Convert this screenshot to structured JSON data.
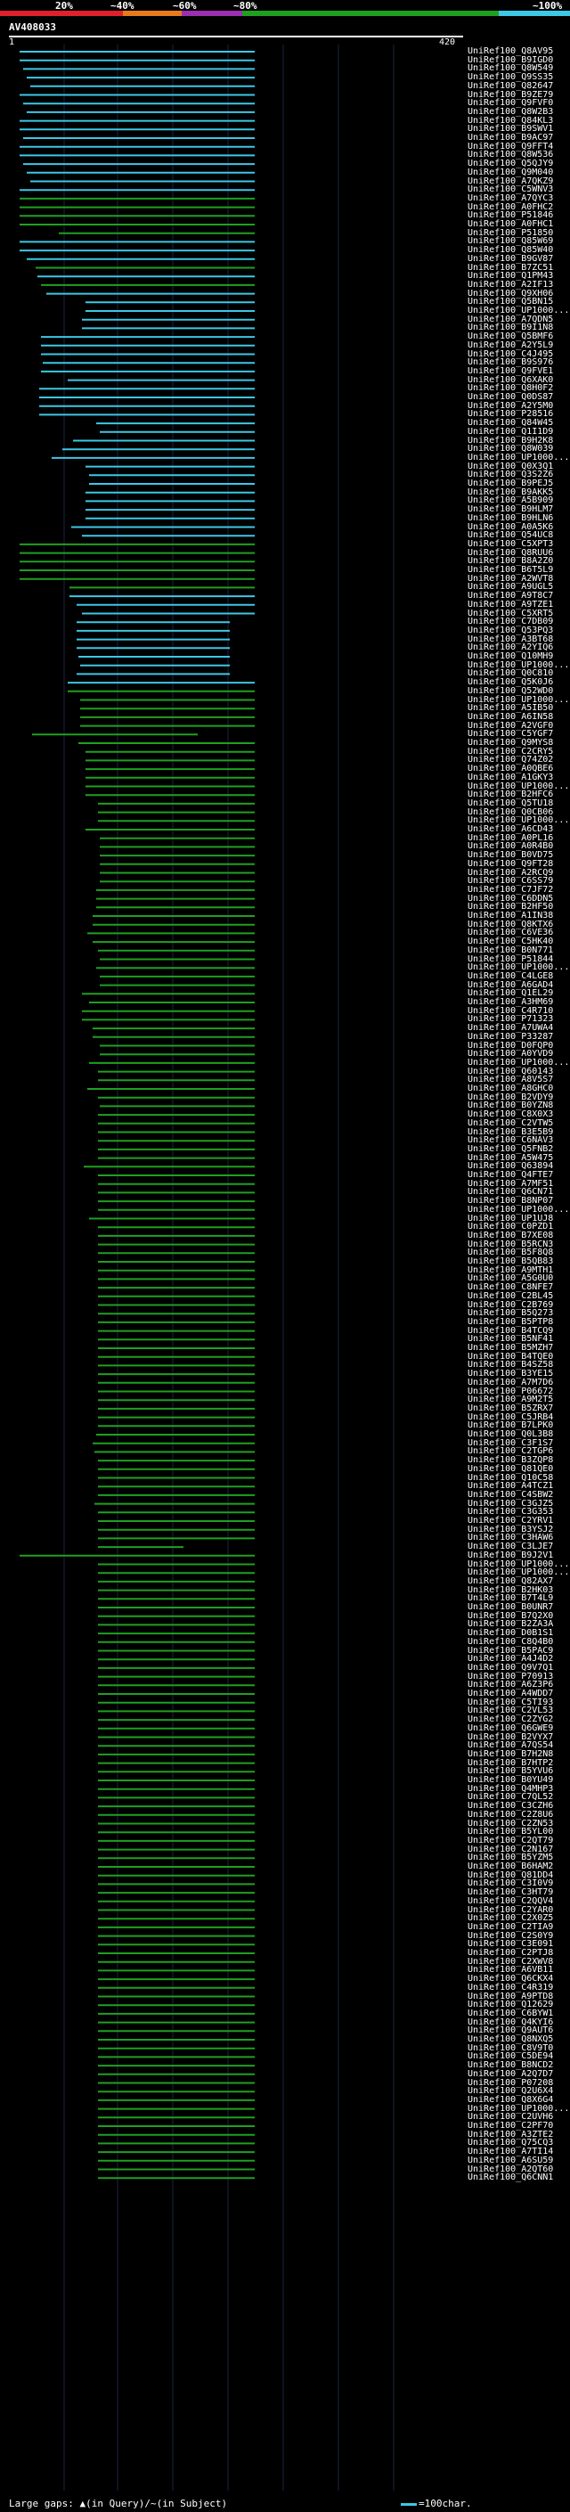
{
  "legend": {
    "labels": [
      "20%",
      "~40%",
      "~60%",
      "~80%",
      "~100%"
    ],
    "colors": [
      "#e0202a",
      "#e87a1c",
      "#9b2fb0",
      "#1fa01f",
      "#3cc8e6"
    ]
  },
  "query_id": "AV408033",
  "scale": {
    "start": "1",
    "end": "420"
  },
  "accessions": [
    "UniRef100_Q8AV95",
    "UniRef100_B9IGD0",
    "UniRef100_Q8W549",
    "UniRef100_Q9SS35",
    "UniRef100_Q82647",
    "UniRef100_B9ZE79",
    "UniRef100_Q9FVF0",
    "UniRef100_Q8W2B3",
    "UniRef100_Q84KL3",
    "UniRef100_B9SWV1",
    "UniRef100_B9AC97",
    "UniRef100_Q9FFT4",
    "UniRef100_Q8W536",
    "UniRef100_Q5QJY9",
    "UniRef100_Q9M040",
    "UniRef100_A7QKZ9",
    "UniRef100_C5WNV3",
    "UniRef100_A7QYC3",
    "UniRef100_A0FHC2",
    "UniRef100_P51846",
    "UniRef100_A0FHC1",
    "UniRef100_P51850",
    "UniRef100_Q85W69",
    "UniRef100_Q85W40",
    "UniRef100_B9GV87",
    "UniRef100_B7ZC51",
    "UniRef100_Q1PM43",
    "UniRef100_A2IF13",
    "UniRef100_Q9XH06",
    "UniRef100_Q5BN15",
    "UniRef100_UP1000...",
    "UniRef100_A7QDN5",
    "UniRef100_B9I1N8",
    "UniRef100_Q5BMF6",
    "UniRef100_A2Y5L9",
    "UniRef100_C4J495",
    "UniRef100_B9S976",
    "UniRef100_Q9FVE1",
    "UniRef100_Q6XAK0",
    "UniRef100_Q8H0F2",
    "UniRef100_Q0DS87",
    "UniRef100_A2Y5M0",
    "UniRef100_P28516",
    "UniRef100_Q84W45",
    "UniRef100_Q1I1D9",
    "UniRef100_B9H2K8",
    "UniRef100_Q8W039",
    "UniRef100_UP1000...",
    "UniRef100_Q0X3Q1",
    "UniRef100_Q3S2Z6",
    "UniRef100_B9PEJ5",
    "UniRef100_B9AKK5",
    "UniRef100_A5B909",
    "UniRef100_B9HLM7",
    "UniRef100_B9HLN6",
    "UniRef100_A0A5K6",
    "UniRef100_Q54UC8",
    "UniRef100_C5XPT3",
    "UniRef100_Q8RUU6",
    "UniRef100_B8A2Z0",
    "UniRef100_B6T5L9",
    "UniRef100_A2WVT8",
    "UniRef100_A9UGL5",
    "UniRef100_A9T8C7",
    "UniRef100_A9TZE1",
    "UniRef100_C5XRT5",
    "UniRef100_C7DB09",
    "UniRef100_Q53PQ3",
    "UniRef100_A3BT68",
    "UniRef100_A2YIQ6",
    "UniRef100_Q10MH9",
    "UniRef100_UP1000...",
    "UniRef100_Q0C810",
    "UniRef100_Q5K0J6",
    "UniRef100_Q52WD0",
    "UniRef100_UP1000...",
    "UniRef100_A5IB50",
    "UniRef100_A6IN58",
    "UniRef100_A2VGF0",
    "UniRef100_C5YGF7",
    "UniRef100_Q9MYS8",
    "UniRef100_C2CRY5",
    "UniRef100_Q74Z02",
    "UniRef100_A0QBE6",
    "UniRef100_A1GKY3",
    "UniRef100_UP1000...",
    "UniRef100_B2HFC6",
    "UniRef100_Q5TU18",
    "UniRef100_Q0CB06",
    "UniRef100_UP1000...",
    "UniRef100_A6CD43",
    "UniRef100_A0PL16",
    "UniRef100_A0R4B0",
    "UniRef100_B0VD75",
    "UniRef100_Q9FT28",
    "UniRef100_A2RCQ9",
    "UniRef100_C6SS79",
    "UniRef100_C7JF72",
    "UniRef100_C6DDN5",
    "UniRef100_B2HF50",
    "UniRef100_A1IN38",
    "UniRef100_Q8KTX6",
    "UniRef100_C6VE36",
    "UniRef100_C5HK40",
    "UniRef100_B0N771",
    "UniRef100_P51844",
    "UniRef100_UP1000...",
    "UniRef100_C4LGE8",
    "UniRef100_A6GAD4",
    "UniRef100_Q1EL29",
    "UniRef100_A3HM69",
    "UniRef100_C4R710",
    "UniRef100_P71323",
    "UniRef100_A7UWA4",
    "UniRef100_P33287",
    "UniRef100_D0FQP0",
    "UniRef100_A0YVD9",
    "UniRef100_UP1000...",
    "UniRef100_Q60143",
    "UniRef100_A8V5S7",
    "UniRef100_A8GHC0",
    "UniRef100_B2VDY9",
    "UniRef100_B0YZN8",
    "UniRef100_C8X0X3",
    "UniRef100_C2VTW5",
    "UniRef100_B3E5B9",
    "UniRef100_C6NAV3",
    "UniRef100_Q5FNB2",
    "UniRef100_A5W475",
    "UniRef100_Q63894",
    "UniRef100_Q4FTE7",
    "UniRef100_A7MF51",
    "UniRef100_Q6CN71",
    "UniRef100_B8NP07",
    "UniRef100_UP1000...",
    "UniRef100_UP1UJ8",
    "UniRef100_C0PZD1",
    "UniRef100_B7XE08",
    "UniRef100_B5RCN3",
    "UniRef100_B5F8Q8",
    "UniRef100_B5QB83",
    "UniRef100_A9MTH1",
    "UniRef100_A5G0U0",
    "UniRef100_C8NFE7",
    "UniRef100_C2BL45",
    "UniRef100_C2B769",
    "UniRef100_B5Q273",
    "UniRef100_B5PTP8",
    "UniRef100_B4TCQ9",
    "UniRef100_B5NF41",
    "UniRef100_B5MZH7",
    "UniRef100_B4TQE0",
    "UniRef100_B4SZ58",
    "UniRef100_B3YE15",
    "UniRef100_A7M7D6",
    "UniRef100_P06672",
    "UniRef100_A9M2T5",
    "UniRef100_B5ZRX7",
    "UniRef100_C5JRB4",
    "UniRef100_B7LPK0",
    "UniRef100_Q0L3B8",
    "UniRef100_C3F1S7",
    "UniRef100_C2TGP6",
    "UniRef100_B3ZQP8",
    "UniRef100_Q81QE0",
    "UniRef100_Q10C58",
    "UniRef100_A4TCZ1",
    "UniRef100_C4SBW2",
    "UniRef100_C3GJZ5",
    "UniRef100_C3G353",
    "UniRef100_C2YRV1",
    "UniRef100_B3YSJ2",
    "UniRef100_C3HAW6",
    "UniRef100_C3LJE7",
    "UniRef100_B9J2V1",
    "UniRef100_UP1000...",
    "UniRef100_UP1000...",
    "UniRef100_Q82AX7",
    "UniRef100_B2HK03",
    "UniRef100_B7T4L9",
    "UniRef100_B0UNR7",
    "UniRef100_B7Q2X0",
    "UniRef100_B2ZA3A",
    "UniRef100_D0B1S1",
    "UniRef100_C8Q4B0",
    "UniRef100_B5PAC9",
    "UniRef100_A4J4D2",
    "UniRef100_Q9V7Q1",
    "UniRef100_P70913",
    "UniRef100_A6Z3P6",
    "UniRef100_A4WDD7",
    "UniRef100_C5TI93",
    "UniRef100_C2VL53",
    "UniRef100_C2ZYG2",
    "UniRef100_Q6GWE9",
    "UniRef100_B2VYX7",
    "UniRef100_A7QS54",
    "UniRef100_B7H2N8",
    "UniRef100_B7HTP2",
    "UniRef100_B5YVU6",
    "UniRef100_B0YU49",
    "UniRef100_Q4MHP3",
    "UniRef100_C7QL52",
    "UniRef100_C3CZH6",
    "UniRef100_C2Z8U6",
    "UniRef100_C2ZN53",
    "UniRef100_B5YL00",
    "UniRef100_C2QT79",
    "UniRef100_C2N167",
    "UniRef100_B5YZM5",
    "UniRef100_B6HAM2",
    "UniRef100_Q81DD4",
    "UniRef100_C3I0V9",
    "UniRef100_C3HT79",
    "UniRef100_C2QQV4",
    "UniRef100_C2YAR0",
    "UniRef100_C2X0Z5",
    "UniRef100_C2TIA9",
    "UniRef100_C2S0Y9",
    "UniRef100_C3E091",
    "UniRef100_C2PTJ8",
    "UniRef100_C2XWV8",
    "UniRef100_A6VB11",
    "UniRef100_Q6CKX4",
    "UniRef100_C4R319",
    "UniRef100_A9PTD8",
    "UniRef100_Q12629",
    "UniRef100_C6BYW1",
    "UniRef100_Q4KYI6",
    "UniRef100_Q9AUT6",
    "UniRef100_Q8NXQ5",
    "UniRef100_C8V9T0",
    "UniRef100_C5DE94",
    "UniRef100_B8NCD2",
    "UniRef100_A2Q7D7",
    "UniRef100_P07208",
    "UniRef100_Q2U6X4",
    "UniRef100_Q8X6G4",
    "UniRef100_UP1000...",
    "UniRef100_C2UVH6",
    "UniRef100_C2PF70",
    "UniRef100_A3ZTE2",
    "UniRef100_Q75CQ3",
    "UniRef100_A7TI14",
    "UniRef100_A6SU59",
    "UniRef100_A2QT60",
    "UniRef100_Q6CNN1"
  ],
  "footer": {
    "gaps_label": "Large gaps: ",
    "query_gap": "▲(in Query)/",
    "subject_gap": "~(in Subject)",
    "key_label": "=100char."
  }
}
